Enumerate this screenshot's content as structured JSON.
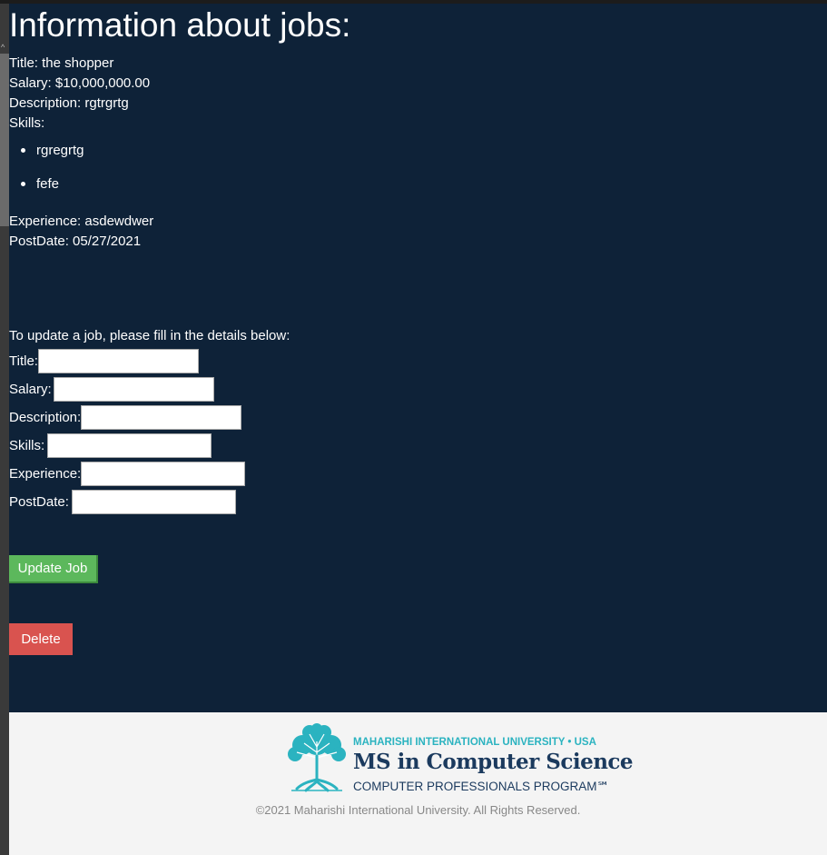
{
  "page": {
    "heading": "Information about jobs:"
  },
  "job": {
    "title_label": "Title: the shopper",
    "salary_label": "Salary: $10,000,000.00",
    "description_label": "Description: rgtrgrtg",
    "skills_label": "Skills:",
    "skills": [
      "rgregrtg",
      "fefe"
    ],
    "experience_label": "Experience: asdewdwer",
    "postdate_label": "PostDate: 05/27/2021"
  },
  "form": {
    "intro": "To update a job, please fill in the details below:",
    "fields": [
      {
        "label": "Title:",
        "value": ""
      },
      {
        "label": "Salary:",
        "value": ""
      },
      {
        "label": "Description:",
        "value": ""
      },
      {
        "label": "Skills:",
        "value": ""
      },
      {
        "label": "Experience:",
        "value": ""
      },
      {
        "label": "PostDate:",
        "value": ""
      }
    ],
    "update_button": "Update Job",
    "delete_button": "Delete"
  },
  "footer": {
    "university": "MAHARISHI INTERNATIONAL UNIVERSITY • USA",
    "program_title": "MS in Computer Science",
    "program_subtitle": "COMPUTER PROFESSIONALS PROGRAM℠",
    "copyright": "©2021 Maharishi International University. All Rights Reserved."
  },
  "colors": {
    "main_bg": "#0e2238",
    "update_button": "#5cb85c",
    "delete_button": "#d9534f",
    "footer_bg": "#f4f4f4",
    "brand_teal": "#2bb3c0",
    "brand_navy": "#1b3a5e"
  }
}
